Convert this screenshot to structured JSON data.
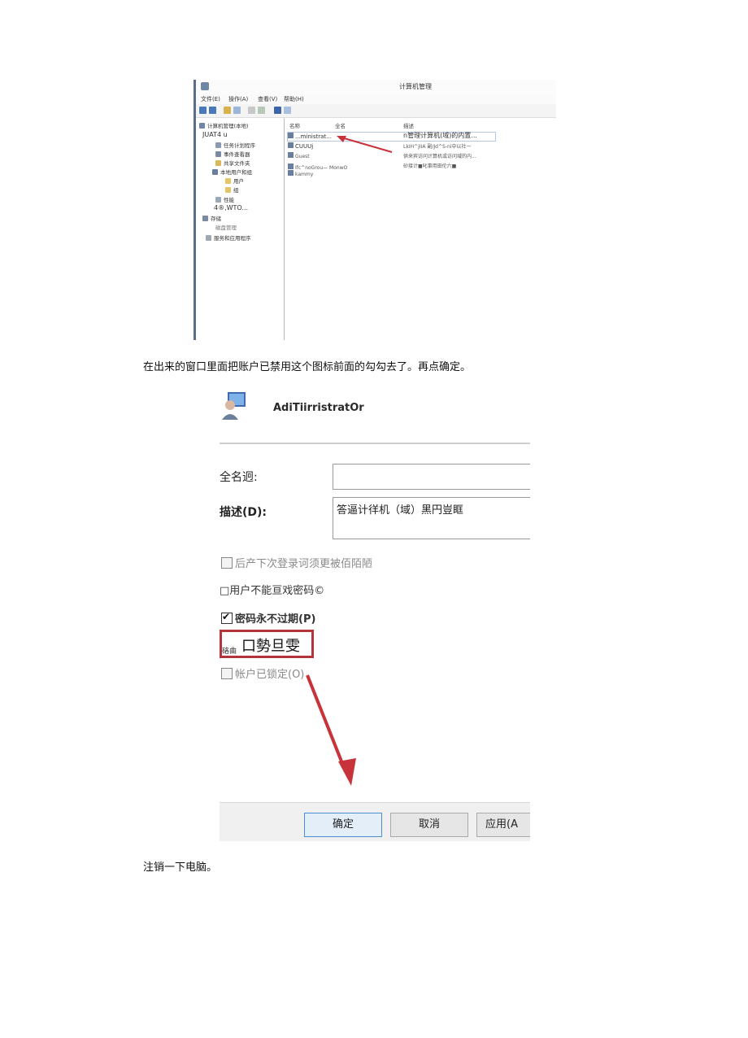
{
  "screenshot1": {
    "window_title": "计算机管理",
    "menus": [
      "文件(E)",
      "操作(A)",
      "查看(V)",
      "帮助(H)"
    ],
    "tree": [
      "计算机管理(本地)",
      "JUAT4 u",
      "任务计划程序",
      "事件查看器",
      "共享文件夹",
      "本地用户和组",
      "用户",
      "组",
      "性能",
      "4®,WTO...",
      "存储",
      "磁盘管理",
      "服务和应用程序"
    ],
    "columns": [
      "名称",
      "全名",
      "描述"
    ],
    "rows": [
      {
        "name": "...ministrat...",
        "full": "",
        "desc": "n管理计算机(域)的内置..."
      },
      {
        "name": "CUUUj",
        "full": "",
        "desc": "LkIH^jIIA 副/Jd^S-ni中以社一"
      },
      {
        "name": "Guest",
        "full": "",
        "desc": "供来宾访问计算机或访问域的内..."
      },
      {
        "name": "Ifc^noGrou— MonwO",
        "full": "",
        "desc": "砂接计■叱事用田伦六■"
      },
      {
        "name": "kammy",
        "full": "",
        "desc": ""
      }
    ]
  },
  "paragraph1": "在出来的窗口里面把账户已禁用这个图标前面的勾勾去了。再点确定。",
  "dialog": {
    "username": "AdiTiirristratOr",
    "fullname_label": "全名迥:",
    "fullname_value": "",
    "description_label": "描述(D):",
    "description_value": "答逼计徉机（域）黑円豈眶",
    "option_must_change": "后产下次登录诃须更被佰陌陋",
    "option_cannot_change": "□用户不能亘戏密码©",
    "option_never_expires": "密码永不过期(P)",
    "option_disabled_text": "口勢旦雯",
    "option_disabled_small": "硌曲",
    "option_locked": "帐户已锁定(O)",
    "btn_ok": "确定",
    "btn_cancel": "取消",
    "btn_apply": "应用(A"
  },
  "paragraph2": "注销一下电脑。",
  "colors": {
    "annotation_red": "#c8333b",
    "highlight_border": "#b3343a"
  }
}
